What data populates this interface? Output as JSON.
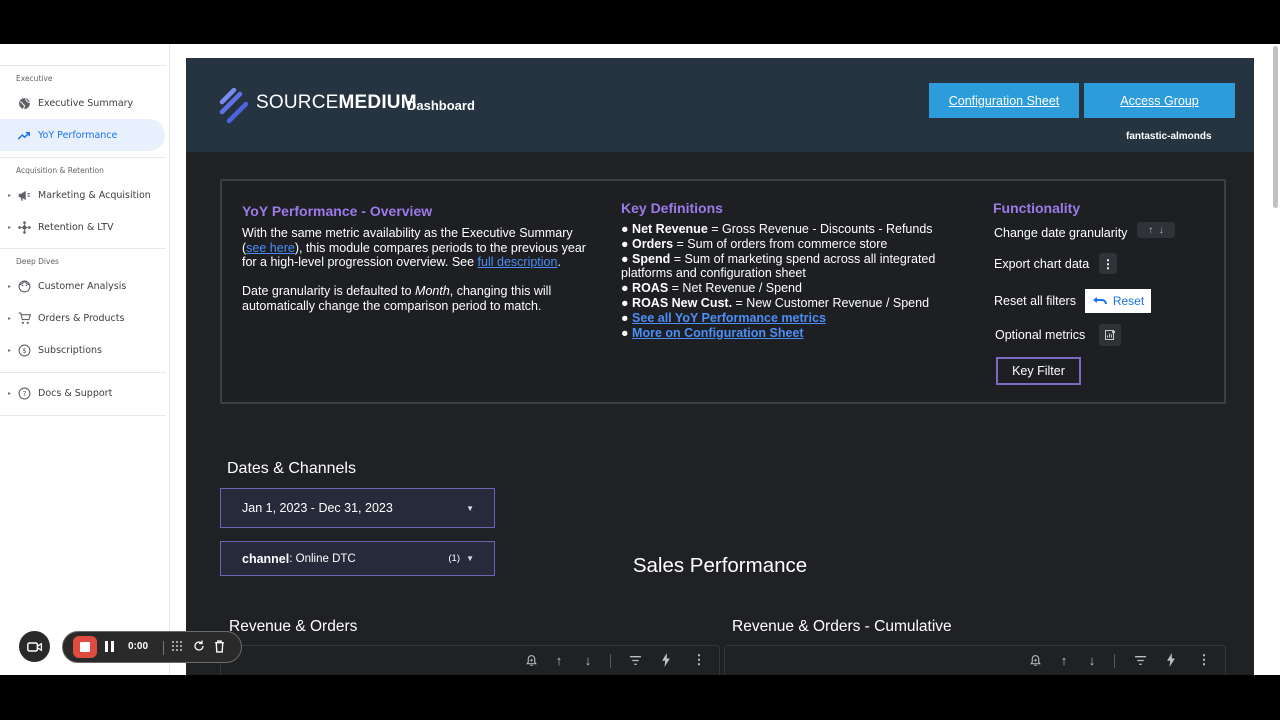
{
  "sidebar": {
    "sections": {
      "executive": "Executive",
      "acquisition": "Acquisition & Retention",
      "deep_dives": "Deep Dives"
    },
    "items": [
      {
        "label": "Executive Summary",
        "icon": "globe-icon",
        "active": false
      },
      {
        "label": "YoY Performance",
        "icon": "trending-up-icon",
        "active": true
      },
      {
        "label": "Marketing & Acquisition",
        "icon": "megaphone-icon",
        "active": false
      },
      {
        "label": "Retention & LTV",
        "icon": "hub-icon",
        "active": false
      },
      {
        "label": "Customer Analysis",
        "icon": "face-icon",
        "active": false
      },
      {
        "label": "Orders & Products",
        "icon": "cart-icon",
        "active": false
      },
      {
        "label": "Subscriptions",
        "icon": "dollar-circle-icon",
        "active": false
      },
      {
        "label": "Docs & Support",
        "icon": "help-circle-icon",
        "active": false
      }
    ],
    "accent_color": "#1a73e8"
  },
  "header": {
    "brand_light": "SOURCE",
    "brand_bold": "MEDIUM",
    "brand_sub": "Dashboard",
    "config_button": "Configuration Sheet",
    "access_button": "Access Group",
    "account": "fantastic-almonds",
    "button_color": "#2d9cdb"
  },
  "overview": {
    "title": "YoY Performance - Overview",
    "p1_a": "With the same metric availability as the Executive Summary (",
    "p1_link": "see here",
    "p1_b": "), this module compares periods to the previous year for a high-level progression overview. See ",
    "p1_link2": "full description",
    "p1_c": ".",
    "p2_a": "Date granularity is defaulted to ",
    "p2_em": "Month",
    "p2_b": ", changing this will automatically change the comparison period to match."
  },
  "definitions": {
    "title": "Key Definitions",
    "items": [
      {
        "term": "Net Revenue",
        "text": " = Gross Revenue - Discounts - Refunds"
      },
      {
        "term": "Orders",
        "text": " = Sum of orders from commerce store"
      },
      {
        "term": "Spend",
        "text": " = Sum of marketing spend across all integrated platforms and configuration sheet"
      },
      {
        "term": "ROAS",
        "text": " = Net Revenue / Spend"
      },
      {
        "term": "ROAS New Cust.",
        "text": " = New Customer Revenue / Spend"
      }
    ],
    "link1": "See all YoY Performance metrics",
    "link2": "More on Configuration Sheet",
    "bullet": "●"
  },
  "functionality": {
    "title": "Functionality",
    "change_granularity": "Change date granularity",
    "export": "Export chart data",
    "reset_filters": "Reset all filters",
    "reset_button": "Reset",
    "optional_metrics": "Optional metrics",
    "key_filter": "Key Filter"
  },
  "controls": {
    "section_label": "Dates & Channels",
    "date_range": "Jan 1, 2023 - Dec 31, 2023",
    "channel_label": "channel",
    "channel_value": ": Online DTC",
    "channel_count": "(1)"
  },
  "sales": {
    "title": "Sales Performance",
    "chart1_title": "Revenue & Orders",
    "chart2_title": "Revenue & Orders - Cumulative"
  },
  "recorder": {
    "time": "0:00",
    "stop_color": "#e04b3f"
  }
}
